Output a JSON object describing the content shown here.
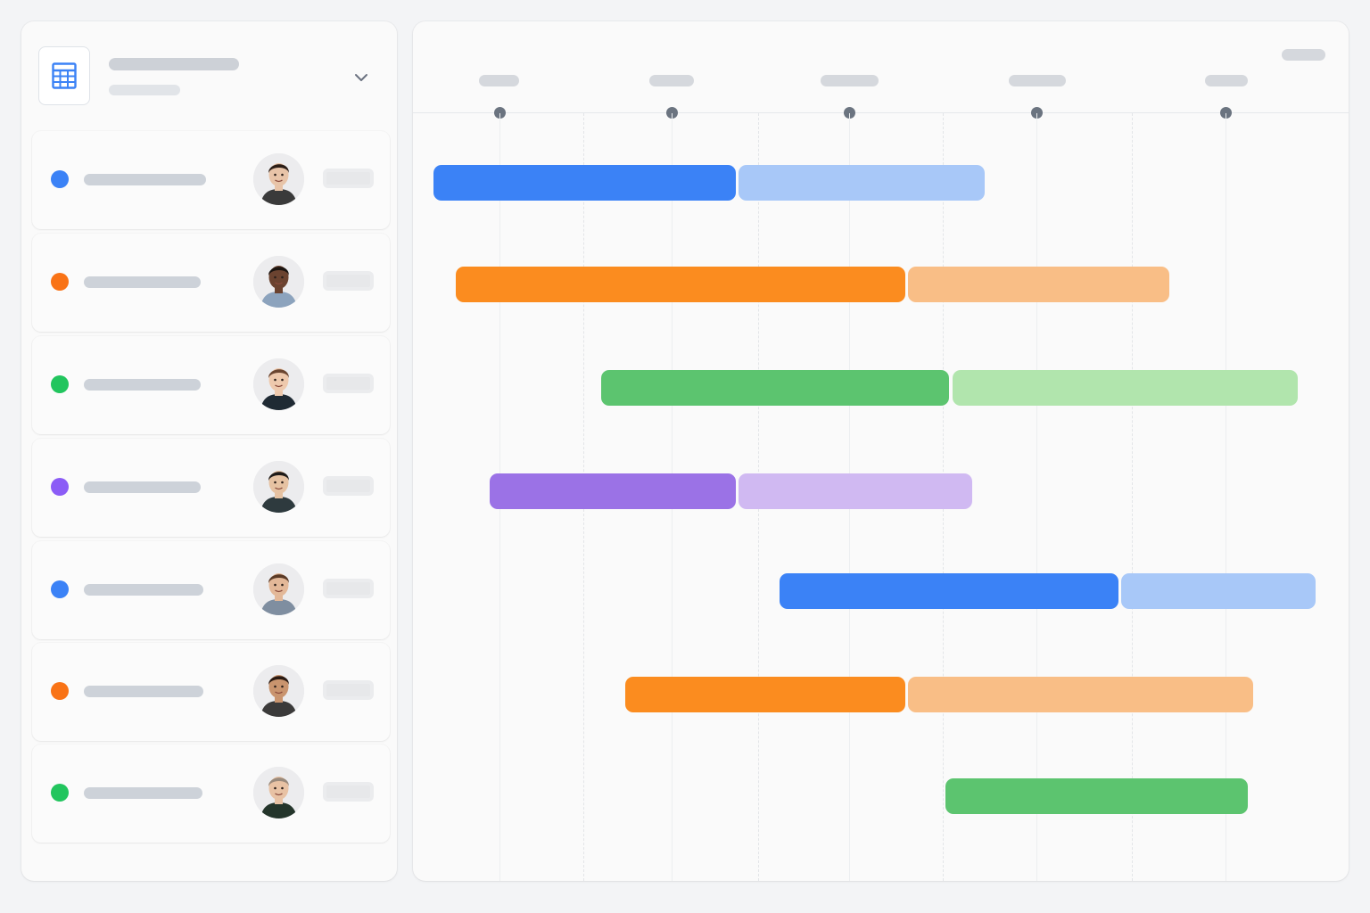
{
  "sidebar": {
    "view_icon": "table-grid-icon",
    "dropdown_icon": "chevron-down-icon",
    "rows": [
      {
        "color": "#3b82f6",
        "avatar_icon": "avatar-woman-long-dark-hair"
      },
      {
        "color": "#f97316",
        "avatar_icon": "avatar-man-short-dark-hair"
      },
      {
        "color": "#22c55e",
        "avatar_icon": "avatar-woman-brown-hair"
      },
      {
        "color": "#8b5cf6",
        "avatar_icon": "avatar-man-glasses"
      },
      {
        "color": "#3b82f6",
        "avatar_icon": "avatar-man-beard"
      },
      {
        "color": "#f97316",
        "avatar_icon": "avatar-woman-curly-hair"
      },
      {
        "color": "#22c55e",
        "avatar_icon": "avatar-man-bald-glasses"
      }
    ]
  },
  "timeline": {
    "colors": {
      "blue": "#3b82f6",
      "blue_light": "#a8c8f8",
      "orange": "#fb8c1f",
      "orange_light": "#f9be86",
      "green": "#5cc46f",
      "green_light": "#b1e5ad",
      "purple": "#9b72e6",
      "purple_light": "#d0b9f2"
    }
  }
}
